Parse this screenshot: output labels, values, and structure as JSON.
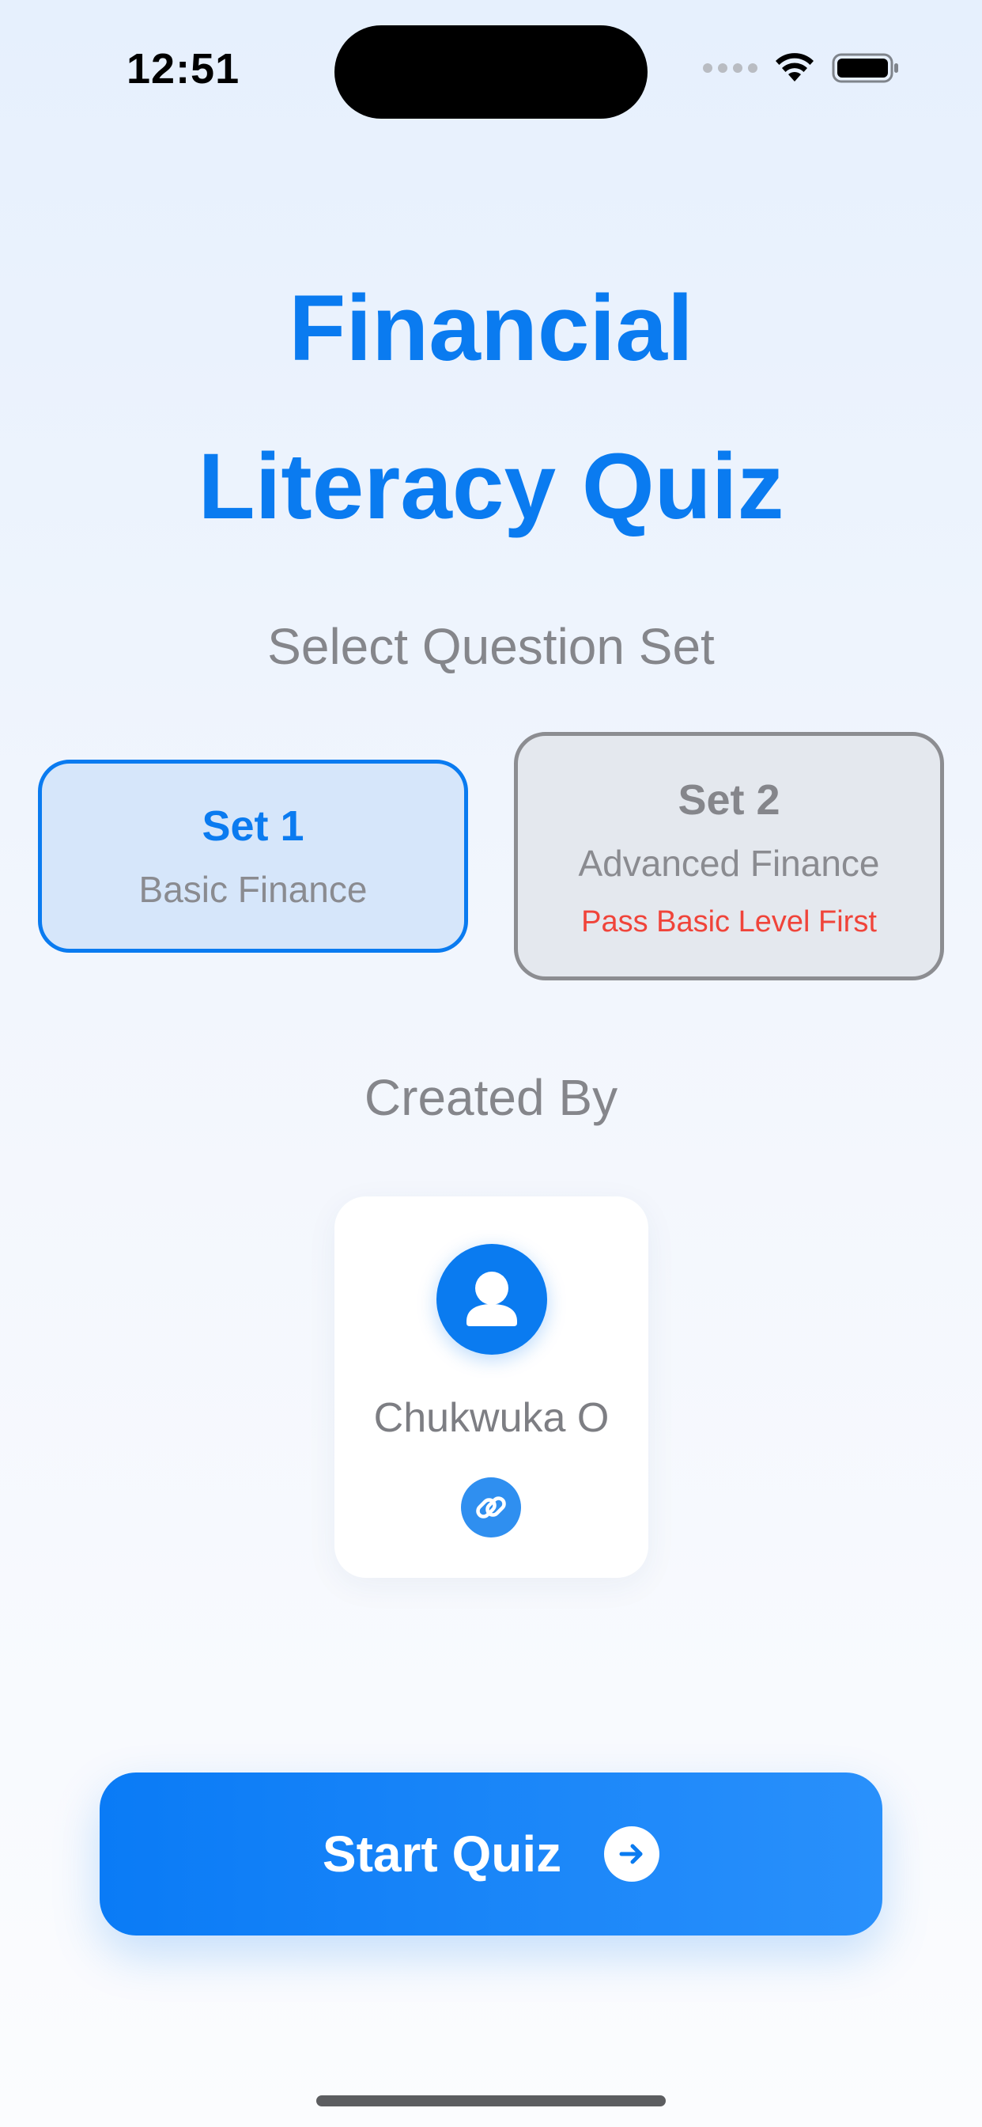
{
  "status_bar": {
    "time": "12:51",
    "icons": [
      "signal-dots-icon",
      "wifi-icon",
      "battery-icon"
    ]
  },
  "title": {
    "line1": "Financial",
    "line2": "Literacy Quiz"
  },
  "set_section": {
    "label": "Select Question Set",
    "sets": [
      {
        "name": "Set 1",
        "description": "Basic Finance",
        "selected": true
      },
      {
        "name": "Set 2",
        "description": "Advanced Finance",
        "note": "Pass Basic Level First",
        "locked": true
      }
    ]
  },
  "creator_section": {
    "label": "Created By",
    "name": "Chukwuka O",
    "avatar_icon": "person-icon",
    "link_icon": "link-icon"
  },
  "start_button": {
    "label": "Start Quiz",
    "icon": "arrow-right-circle-icon"
  },
  "colors": {
    "accent": "#0A7BF0",
    "muted_text": "#85868B",
    "warning": "#F0443A",
    "selected_bg": "#D6E6FA",
    "locked_bg": "#E4E8EE"
  }
}
